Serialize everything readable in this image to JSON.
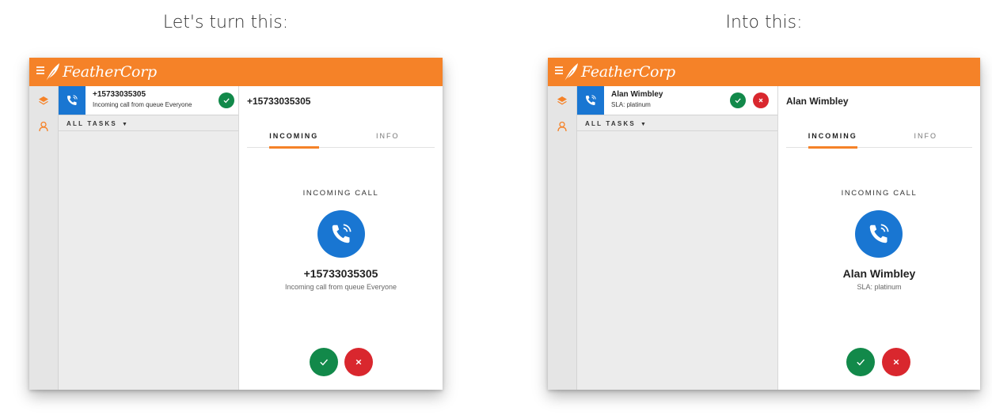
{
  "captions": {
    "left": "Let's turn this:",
    "right": "Into this:"
  },
  "colors": {
    "brand_orange": "#f58228",
    "call_blue": "#1976d2",
    "accept_green": "#12894a",
    "reject_red": "#d9272e"
  },
  "icons": [
    "menu-icon",
    "feather-logo-icon",
    "layers-icon",
    "agent-icon",
    "phone-icon",
    "check-icon",
    "close-icon",
    "caret-down-icon"
  ],
  "before": {
    "brand": "FeatherCorp",
    "task": {
      "title": "+15733035305",
      "subtitle": "Incoming call from queue Everyone"
    },
    "filter_label": "ALL TASKS",
    "detail": {
      "title": "+15733035305",
      "tabs": [
        "INCOMING",
        "INFO"
      ],
      "incoming_label": "INCOMING CALL",
      "caller_name": "+15733035305",
      "caller_sub": "Incoming call from queue Everyone"
    }
  },
  "after": {
    "brand": "FeatherCorp",
    "task": {
      "title": "Alan Wimbley",
      "subtitle": "SLA: platinum"
    },
    "filter_label": "ALL TASKS",
    "detail": {
      "title": "Alan Wimbley",
      "tabs": [
        "INCOMING",
        "INFO"
      ],
      "incoming_label": "INCOMING CALL",
      "caller_name": "Alan Wimbley",
      "caller_sub": "SLA: platinum"
    }
  }
}
